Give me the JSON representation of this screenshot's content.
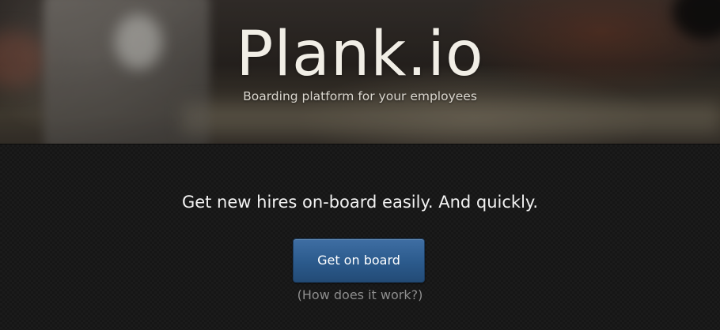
{
  "hero": {
    "brand_name": "Plank.io",
    "tagline": "Boarding platform for your employees"
  },
  "main": {
    "headline": "Get new hires on-board easily. And quickly.",
    "cta_label": "Get on board",
    "help_link": "(How does it work?)"
  },
  "colors": {
    "button_accent": "#2b5a8c",
    "background": "#171717",
    "title_text": "#f1eee6"
  }
}
